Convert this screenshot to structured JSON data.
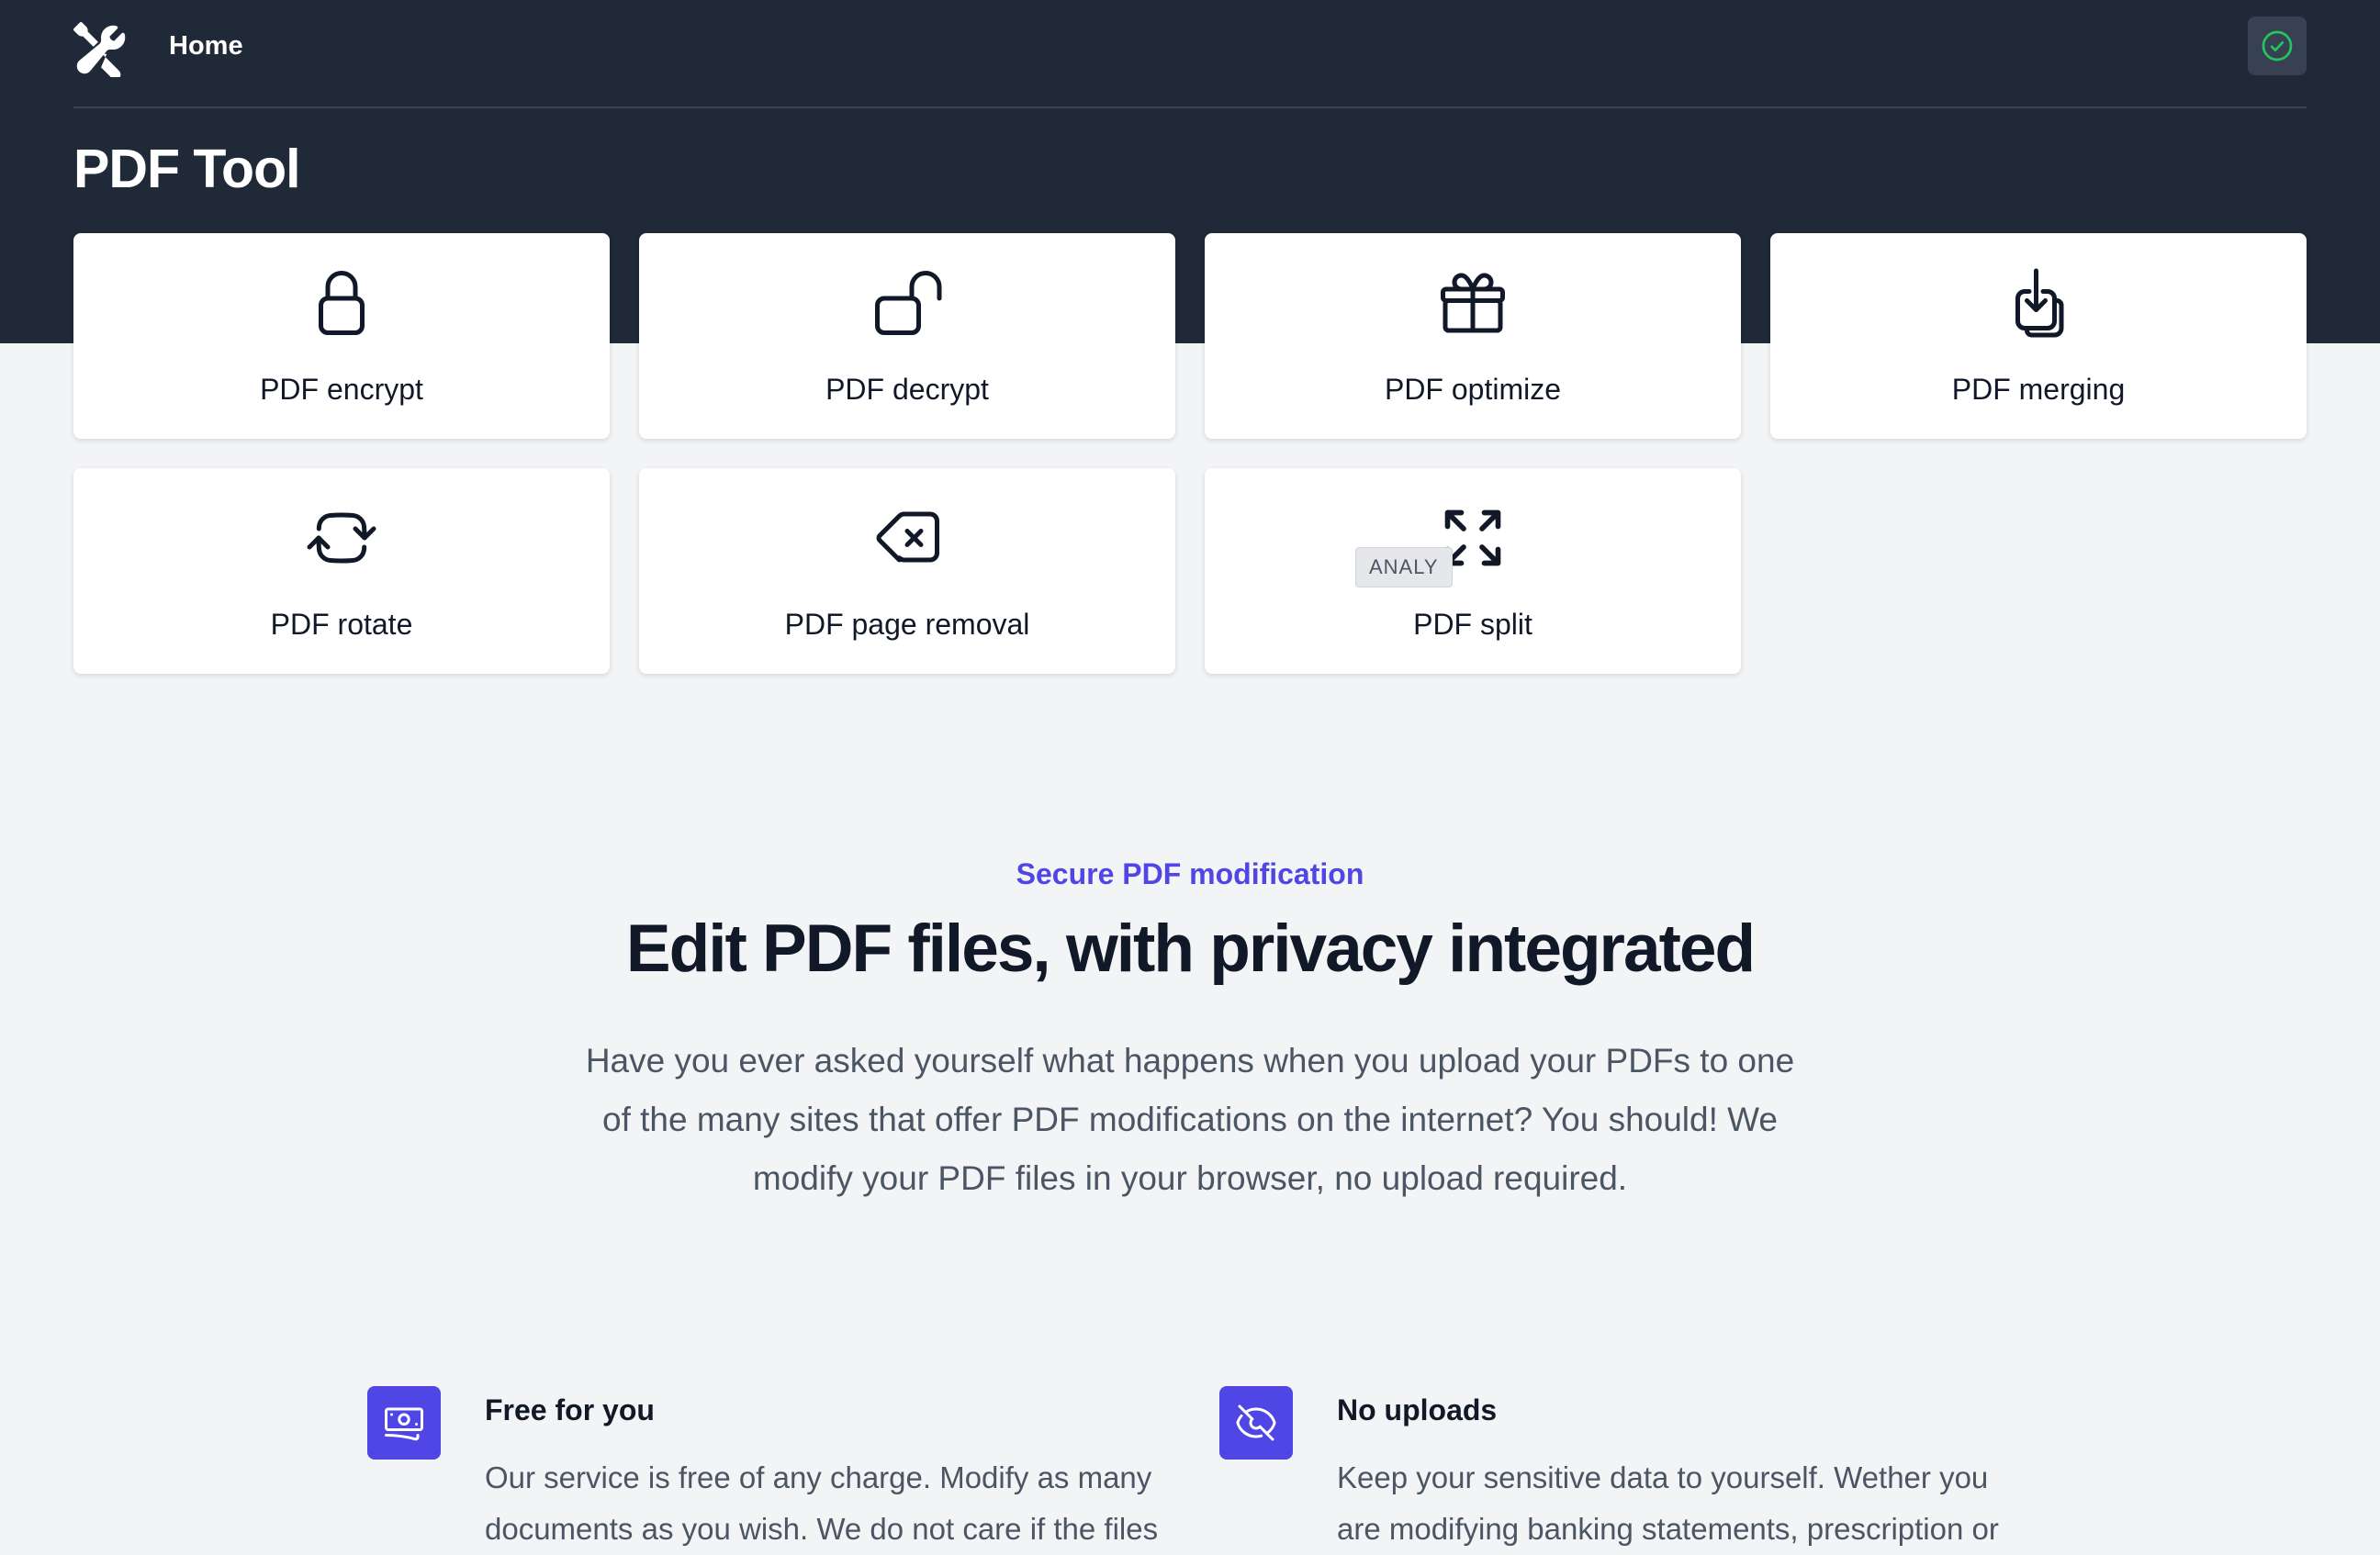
{
  "nav": {
    "logo_icon": "wrench-screwdriver-icon",
    "home_label": "Home",
    "status_icon": "check-circle-icon"
  },
  "page_title": "PDF Tool",
  "tools": [
    {
      "label": "PDF encrypt",
      "icon": "lock-closed-icon"
    },
    {
      "label": "PDF decrypt",
      "icon": "lock-open-icon"
    },
    {
      "label": "PDF optimize",
      "icon": "gift-icon"
    },
    {
      "label": "PDF merging",
      "icon": "document-download-icon"
    },
    {
      "label": "PDF rotate",
      "icon": "arrows-rotate-icon"
    },
    {
      "label": "PDF page removal",
      "icon": "backspace-icon"
    },
    {
      "label": "PDF split",
      "icon": "arrows-expand-icon"
    }
  ],
  "tooltip": "ANALY",
  "section": {
    "eyebrow": "Secure PDF modification",
    "headline": "Edit PDF files, with privacy integrated",
    "lead": "Have you ever asked yourself what happens when you upload your PDFs to one of the many sites that offer PDF modifications on the internet? You should! We modify your PDF files in your browser, no upload required."
  },
  "features": [
    {
      "icon": "cash-icon",
      "title": "Free for you",
      "description": "Our service is free of any charge. Modify as many documents as you wish. We do not care if the files"
    },
    {
      "icon": "eye-off-icon",
      "title": "No uploads",
      "description": "Keep your sensitive data to yourself. Wether you are modifying banking statements, prescription or"
    }
  ],
  "colors": {
    "header_bg": "#1f2937",
    "page_bg": "#f3f4f6",
    "accent": "#4f46e5",
    "status_green": "#22c55e"
  }
}
